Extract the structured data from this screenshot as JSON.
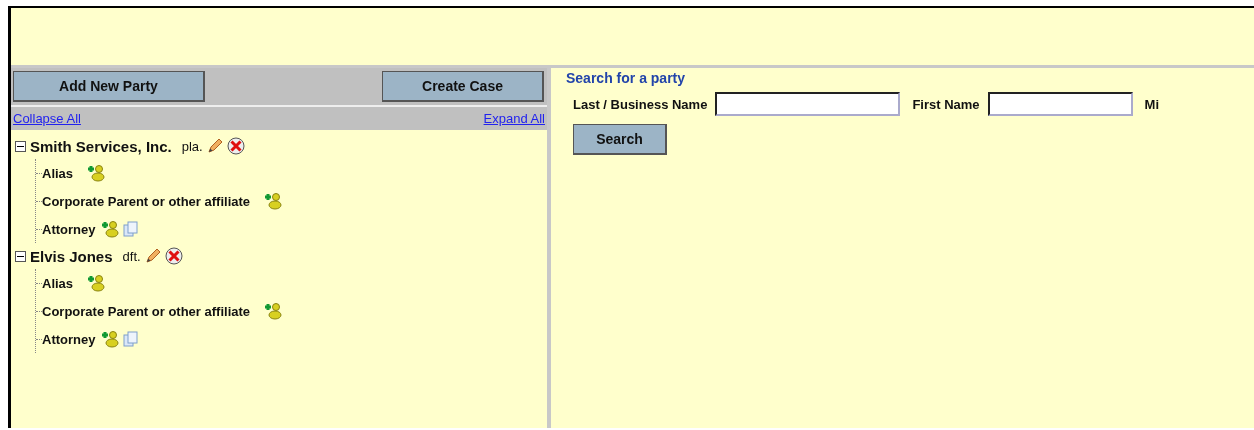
{
  "toolbar": {
    "buttons": [
      "Add New Party",
      "Create Case"
    ]
  },
  "tree_links": [
    "Collapse All",
    "Expand All"
  ],
  "parties": [
    {
      "name": "Smith Services, Inc.",
      "role": "pla.",
      "expanded": true,
      "children": [
        {
          "label": "Alias",
          "kind": "add"
        },
        {
          "label": "Corporate Parent or other affiliate",
          "kind": "add"
        },
        {
          "label": "Attorney",
          "kind": "add-copy"
        }
      ]
    },
    {
      "name": "Elvis Jones",
      "role": "dft.",
      "expanded": true,
      "children": [
        {
          "label": "Alias",
          "kind": "add"
        },
        {
          "label": "Corporate Parent or other affiliate",
          "kind": "add"
        },
        {
          "label": "Attorney",
          "kind": "add-copy"
        }
      ]
    }
  ],
  "search": {
    "title": "Search for a party",
    "fields": [
      {
        "label": "Last / Business Name"
      },
      {
        "label": "First Name"
      },
      {
        "label": "Mi"
      }
    ],
    "button": "Search"
  }
}
